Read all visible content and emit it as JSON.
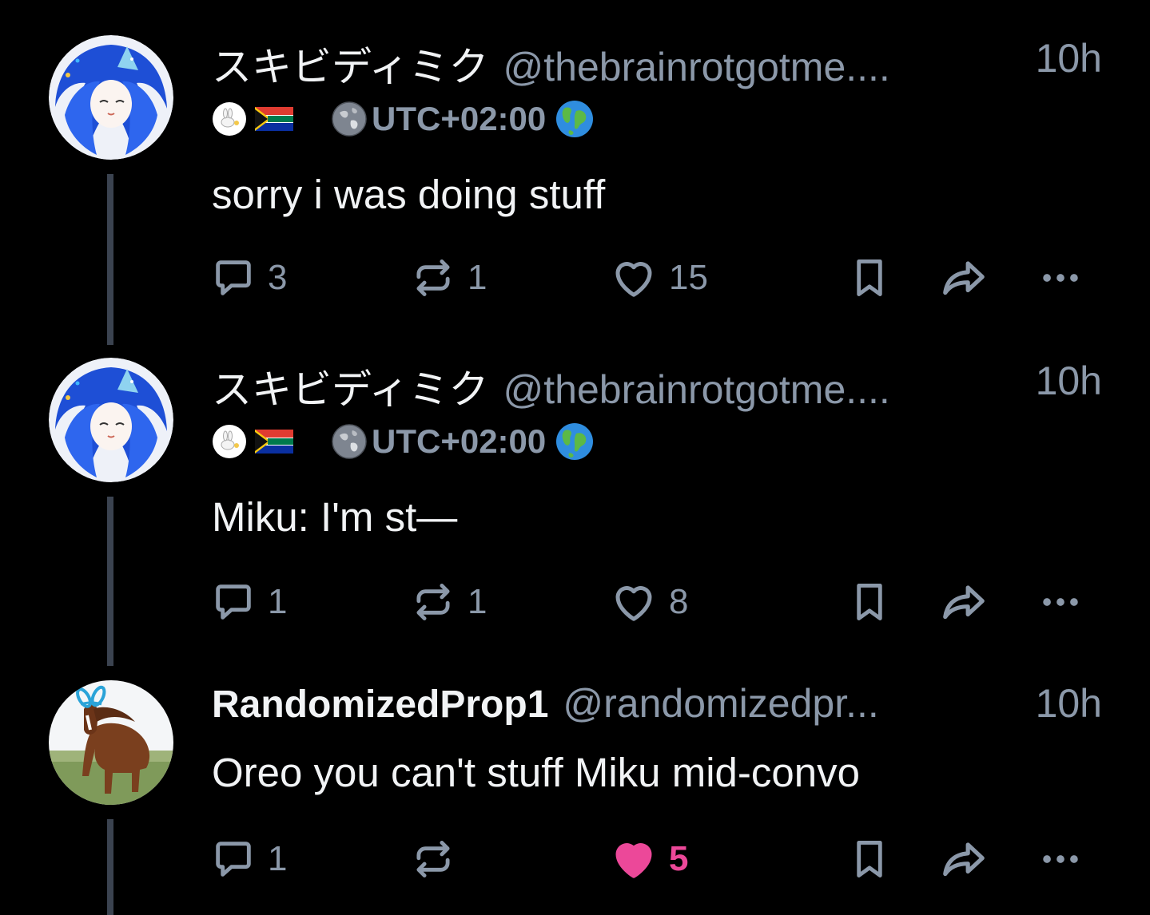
{
  "posts": [
    {
      "display_name": "スキビディミク",
      "handle": "@thebrainrotgotme....",
      "time": "10h",
      "utc": "UTC+02:00",
      "text": "sorry i was doing stuff",
      "replies": "3",
      "reposts": "1",
      "likes": "15",
      "liked": false
    },
    {
      "display_name": "スキビディミク",
      "handle": "@thebrainrotgotme....",
      "time": "10h",
      "utc": "UTC+02:00",
      "text": "Miku: I'm st—",
      "replies": "1",
      "reposts": "1",
      "likes": "8",
      "liked": false
    },
    {
      "display_name": "RandomizedProp1",
      "handle": "@randomizedpr...",
      "time": "10h",
      "text": "Oreo you can't stuff Miku mid-convo",
      "replies": "1",
      "reposts": "",
      "likes": "5",
      "liked": true
    }
  ],
  "colors": {
    "background": "#000000",
    "text": "#f1f3f5",
    "muted": "#8b98a9",
    "like_active": "#ec4899",
    "thread_line": "#3b4350"
  },
  "icons": [
    "reply-icon",
    "repost-icon",
    "heart-icon",
    "bookmark-icon",
    "share-icon",
    "more-icon",
    "bunny-emoji-icon",
    "south-africa-flag-icon",
    "earth-photo-icon",
    "globe-emoji-icon"
  ]
}
